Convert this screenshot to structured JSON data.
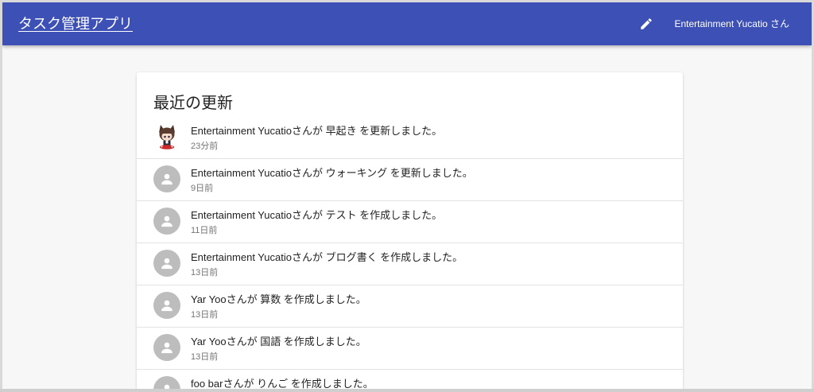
{
  "header": {
    "title": "タスク管理アプリ",
    "user_label": "Entertainment Yucatio さん",
    "edit_icon": "pencil-icon",
    "bar_color": "#3d50b5"
  },
  "updates": {
    "heading": "最近の更新",
    "items": [
      {
        "text": "Entertainment Yucatioさんが 早起き を更新しました。",
        "time": "23分前",
        "avatar": "character-avatar"
      },
      {
        "text": "Entertainment Yucatioさんが ウォーキング を更新しました。",
        "time": "9日前",
        "avatar": "person-icon"
      },
      {
        "text": "Entertainment Yucatioさんが テスト を作成しました。",
        "time": "11日前",
        "avatar": "person-icon"
      },
      {
        "text": "Entertainment Yucatioさんが ブログ書く を作成しました。",
        "time": "13日前",
        "avatar": "person-icon"
      },
      {
        "text": "Yar Yooさんが 算数 を作成しました。",
        "time": "13日前",
        "avatar": "person-icon"
      },
      {
        "text": "Yar Yooさんが 国語 を作成しました。",
        "time": "13日前",
        "avatar": "person-icon"
      },
      {
        "text": "foo barさんが りんご を作成しました。",
        "time": "",
        "avatar": "person-icon"
      }
    ]
  }
}
